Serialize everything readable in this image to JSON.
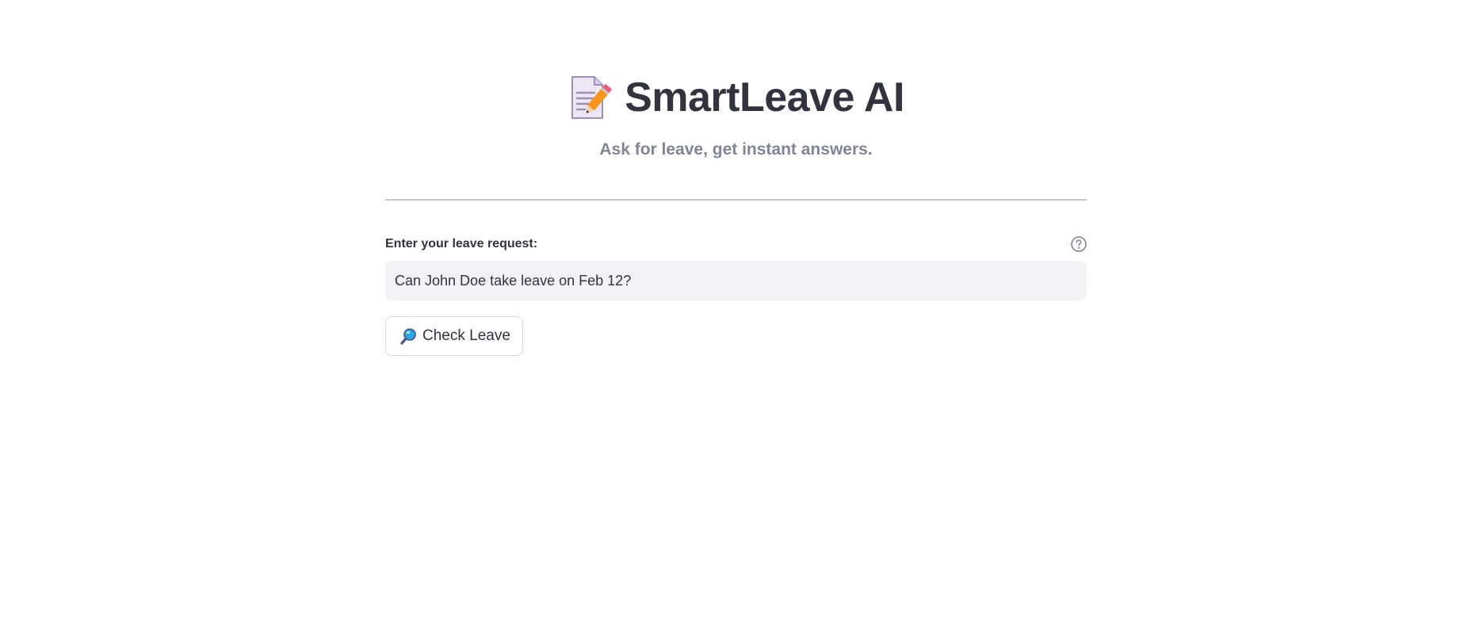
{
  "header": {
    "title_icon": "memo-pencil-icon",
    "title": "SmartLeave AI",
    "subtitle": "Ask for leave, get instant answers."
  },
  "form": {
    "label": "Enter your leave request:",
    "help_icon": "question-circle-icon",
    "input_value": "Can John Doe take leave on Feb 12?",
    "button_icon": "magnifier-icon",
    "button_label": "Check Leave"
  },
  "colors": {
    "text": "#31333f",
    "subtitle": "#808495",
    "input_bg": "#f0f2f6",
    "divider": "#c4c6cb"
  }
}
